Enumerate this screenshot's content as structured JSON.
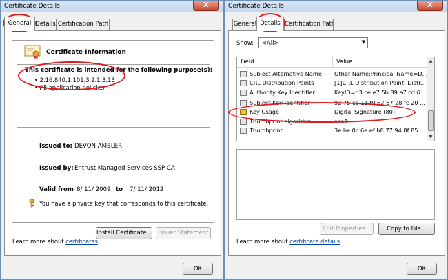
{
  "left": {
    "title": "Certificate Details",
    "close_label": "X",
    "tabs": [
      "General",
      "Details",
      "Certification Path"
    ],
    "cert_info_heading": "Certificate Information",
    "purpose_heading": "This certificate is intended for the following purpose(s):",
    "purposes": [
      "2.16.840.1.101.3.2.1.3.13",
      "All application policies"
    ],
    "issued_to_label": "Issued to:",
    "issued_to_value": "DEVON AMBLER",
    "issued_by_label": "Issued by:",
    "issued_by_value": "Entrust Managed Services SSP CA",
    "valid_from_label": "Valid from",
    "valid_from_value": "8/ 11/ 2009",
    "valid_to_label": "to",
    "valid_to_value": "7/ 11/ 2012",
    "private_key_note": "You have a private key that corresponds to this certificate.",
    "install_button": "Install Certificate...",
    "issuer_statement_button": "Issuer Statement",
    "learn_more_prefix": "Learn more about ",
    "learn_more_link": "certificates",
    "ok_button": "OK"
  },
  "right": {
    "title": "Certificate Details",
    "close_label": "X",
    "tabs": [
      "General",
      "Details",
      "Certification Path"
    ],
    "show_label": "Show:",
    "show_value": "<All>",
    "col_field": "Field",
    "col_value": "Value",
    "rows": [
      {
        "field": "Subject Alternative Name",
        "value": "Other Name:Principal Name=D...",
        "icon": "cert-field-icon"
      },
      {
        "field": "CRL Distribution Points",
        "value": "[1]CRL Distribution Point: Distr...",
        "icon": "cert-field-icon"
      },
      {
        "field": "Authority Key Identifier",
        "value": "KeyID=d3 ce e7 5b 89 a7 cd 6...",
        "icon": "cert-field-icon"
      },
      {
        "field": "Subject Key Identifier",
        "value": "92 75 cd 11 f9 62 67 28 fc 20 ...",
        "icon": "cert-field-icon"
      },
      {
        "field": "Key Usage",
        "value": "Digital Signature (80)",
        "icon": "warning-icon"
      },
      {
        "field": "Thumbprint algorithm",
        "value": "sha1",
        "icon": "cert-field-icon"
      },
      {
        "field": "Thumbprint",
        "value": "3e be 0c 6e ef b8 77 94 8f 85 ...",
        "icon": "cert-field-icon"
      }
    ],
    "edit_properties_button": "Edit Properties...",
    "copy_to_file_button": "Copy to File...",
    "learn_more_prefix": "Learn more about ",
    "learn_more_link": "certificate details",
    "ok_button": "OK"
  },
  "colors": {
    "annotation_red": "#e0191c",
    "link_blue": "#0645ad",
    "close_red": "#c8452d"
  }
}
